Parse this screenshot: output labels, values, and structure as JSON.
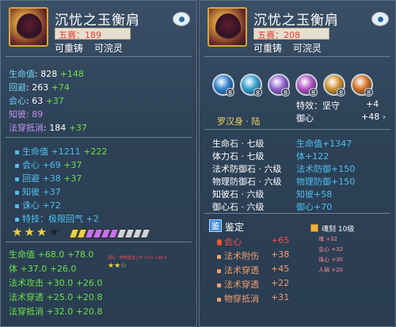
{
  "left": {
    "item_name": "沉忧之玉衡肩",
    "price": "五赛：189",
    "tags": [
      "可重铸",
      "可浣灵"
    ],
    "base_stats": [
      {
        "label": "生命值",
        "value": ": 828",
        "bonus": "+148"
      },
      {
        "label": "回避",
        "value": ": 263",
        "bonus": "+74"
      },
      {
        "label": "会心",
        "value": ": 63",
        "bonus": "+37"
      },
      {
        "label": "知彼",
        "value": ": 89",
        "bonus": ""
      },
      {
        "label": "法穿抵消",
        "value": ": 184",
        "bonus": "+37"
      }
    ],
    "extra_stats": [
      {
        "label": "生命值",
        "value": "+1211",
        "bonus": "+222"
      },
      {
        "label": "会心",
        "value": "+69",
        "bonus": "+37"
      },
      {
        "label": "回避",
        "value": "+38",
        "bonus": "+37"
      },
      {
        "label": "知彼",
        "value": "+37",
        "bonus": ""
      },
      {
        "label": "诛心",
        "value": "+72",
        "bonus": ""
      },
      {
        "label": "特技：极限回气",
        "value": "+2",
        "bonus": ""
      }
    ],
    "stars_filled": 3,
    "stars_total": 4,
    "bar_colors": [
      "#e8d040",
      "#e8d040",
      "#c870f0",
      "#c870f0",
      "#c870f0",
      "#c870f0",
      "#d0d4d8",
      "#d0d4d8",
      "#d0d4d8",
      "#d0d4d8"
    ],
    "refine_stats": [
      {
        "label": "生命值",
        "value": "+68.0",
        "bonus": "+78.0"
      },
      {
        "label": "体",
        "value": "+37.0",
        "bonus": "+26.0"
      },
      {
        "label": "法术攻击",
        "value": "+30.0",
        "bonus": "+26.0"
      },
      {
        "label": "法术穿透",
        "value": "+25.0",
        "bonus": "+20.8"
      },
      {
        "label": "法穿抵消",
        "value": "+32.0",
        "bonus": "+20.8"
      }
    ],
    "mini_text": "团队 · 穿刺重击上升 13.0 +26.0"
  },
  "right": {
    "item_name": "沉忧之玉衡肩",
    "price": "五赛：208",
    "tags": [
      "可重铸",
      "可浣灵"
    ],
    "gem_colors": [
      "#2f7fd0",
      "#2f9fd0",
      "#9060d0",
      "#b050c0",
      "#d09030",
      "#d07020"
    ],
    "gem_levels": [
      "8",
      "8",
      "8",
      "8",
      "8",
      "8"
    ],
    "trait_label": "特效：坚守",
    "trait_value": "+4",
    "suit_name": "罗汉身 · 陆",
    "suit_label": "御心",
    "suit_value": "+48",
    "stones": [
      {
        "name": "生命石 · 七级",
        "effect": "生命值+1347"
      },
      {
        "name": "体力石 · 七级",
        "effect": "体+122"
      },
      {
        "name": "法术防御石 · 六级",
        "effect": "法术防御+150"
      },
      {
        "name": "物理防御石 · 六级",
        "effect": "物理防御+150"
      },
      {
        "name": "知彼石 · 六级",
        "effect": "知彼+58"
      },
      {
        "name": "御心石 · 六级",
        "effect": "御心+70"
      }
    ],
    "identify_label": "鉴定",
    "identify_icon_text": "鉴",
    "identify_stats": [
      {
        "label": "会心",
        "value": "+65"
      },
      {
        "label": "法术附伤",
        "value": "+38"
      },
      {
        "label": "法术穿透",
        "value": "+45"
      },
      {
        "label": "法术穿透",
        "value": "+22"
      },
      {
        "label": "物穿抵消",
        "value": "+31"
      }
    ],
    "soul_title": "魂刻",
    "soul_level": "10级",
    "soul_stats": [
      {
        "label": "魂",
        "value": "+32"
      },
      {
        "label": "会心",
        "value": "+32"
      },
      {
        "label": "诛心",
        "value": "+30"
      },
      {
        "label": "人祸",
        "value": "+20"
      }
    ]
  }
}
